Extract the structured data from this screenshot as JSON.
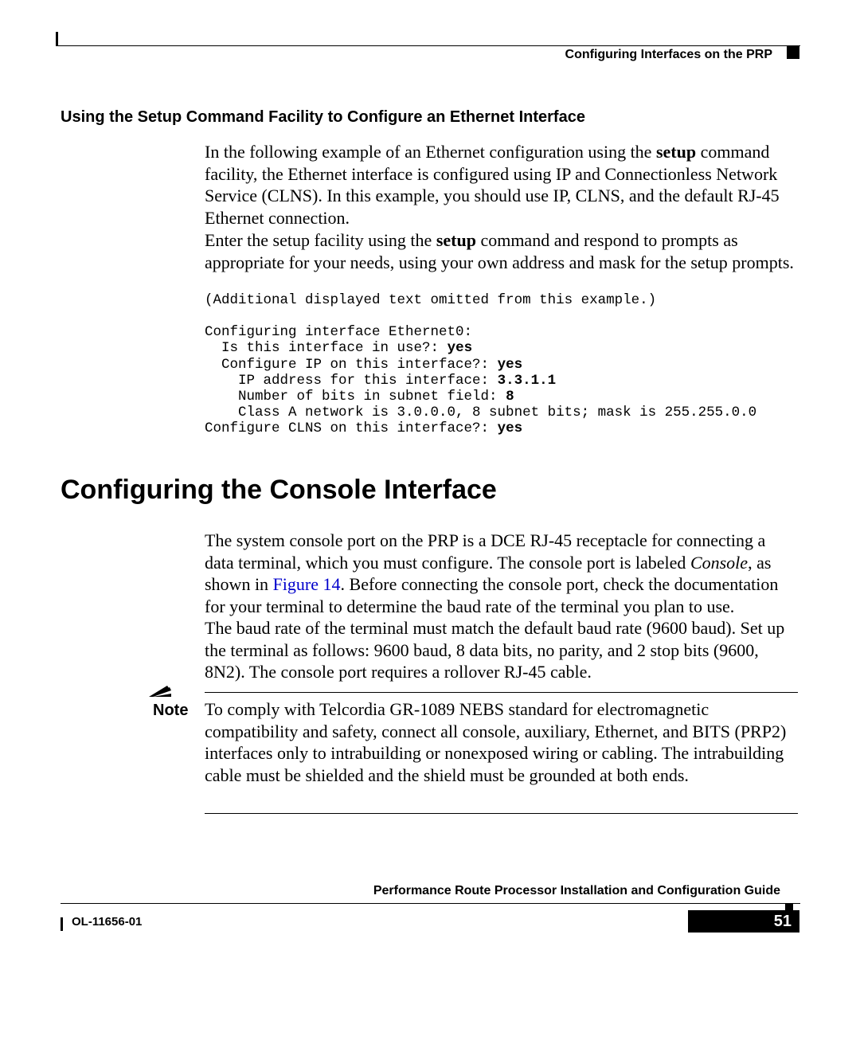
{
  "header": {
    "running_title": "Configuring Interfaces on the PRP"
  },
  "sections": {
    "setup_eth": {
      "heading": "Using the Setup Command Facility to Configure an Ethernet Interface",
      "p1_pre": "In the following example of an Ethernet configuration using the ",
      "p1_cmd": "setup",
      "p1_post": " command facility, the Ethernet interface is configured using IP and Connectionless Network Service (CLNS). In this example, you should use IP, CLNS, and the default RJ-45 Ethernet connection.",
      "p2_pre": "Enter the setup facility using the ",
      "p2_cmd": "setup",
      "p2_post": " command and respond to prompts as appropriate for your needs, using your own address and mask for the setup prompts.",
      "code": {
        "l1": "(Additional displayed text omitted from this example.)",
        "blank1": "",
        "l2": "Configuring interface Ethernet0:",
        "l3": "  Is this interface in use?: ",
        "l3b": "yes",
        "l4": "  Configure IP on this interface?: ",
        "l4b": "yes",
        "l5": "    IP address for this interface: ",
        "l5b": "3.3.1.1",
        "l6": "    Number of bits in subnet field: ",
        "l6b": "8",
        "l7": "    Class A network is 3.0.0.0, 8 subnet bits; mask is 255.255.0.0",
        "l8": "Configure CLNS on this interface?: ",
        "l8b": "yes"
      }
    },
    "console": {
      "heading": "Configuring the Console Interface",
      "p1_a": "The system console port on the PRP is a DCE RJ-45 receptacle for connecting a data terminal, which you must configure. The console port is labeled ",
      "p1_italic": "Console",
      "p1_b": ", as shown in ",
      "figref": "Figure 14",
      "p1_c": ". Before connecting the console port, check the documentation for your terminal to determine the baud rate of the terminal you plan to use.",
      "p2": "The baud rate of the terminal must match the default baud rate (9600 baud). Set up the terminal as follows: 9600 baud, 8 data bits, no parity, and 2 stop bits (9600, 8N2). The console port requires a rollover RJ-45 cable.",
      "note_label": "Note",
      "note_body": "To comply with Telcordia GR-1089 NEBS standard for electromagnetic compatibility and safety, connect all console, auxiliary, Ethernet, and BITS (PRP2) interfaces only to intrabuilding or nonexposed wiring or cabling. The intrabuilding cable must be shielded and the shield must be grounded at both ends."
    }
  },
  "footer": {
    "guide_title": "Performance Route Processor Installation and Configuration Guide",
    "doc_id": "OL-11656-01",
    "page_number": "51"
  }
}
